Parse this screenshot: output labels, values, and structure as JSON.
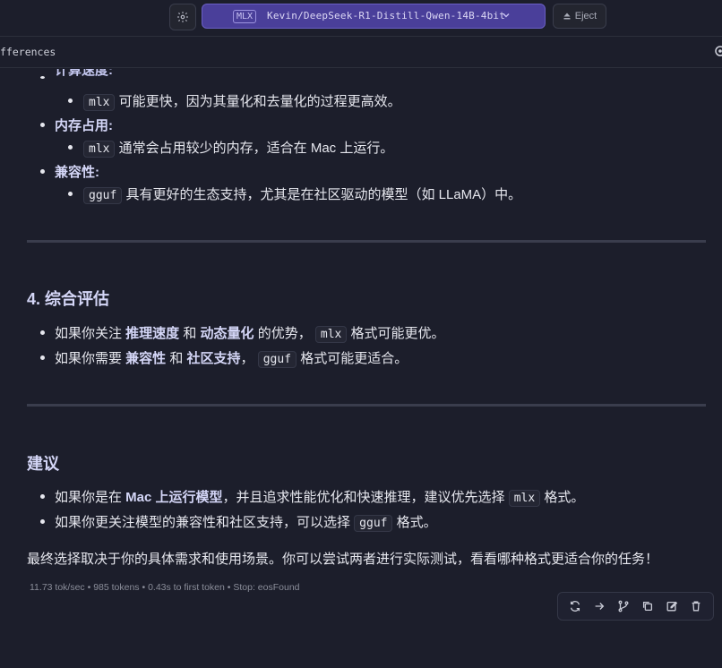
{
  "topbar": {
    "model_badge": "MLX",
    "model_name": "Kevin/DeepSeek-R1-Distill-Qwen-14B-4bit",
    "eject_label": "Eject"
  },
  "subbar": {
    "label": "fferences"
  },
  "section_top": {
    "clipped_heading": "计算速度:",
    "items": [
      {
        "label": "内存占用:",
        "code": "mlx",
        "text": "通常会占用较少的内存，适合在 Mac 上运行。"
      },
      {
        "label": "兼容性:",
        "code": "gguf",
        "text": "具有更好的生态支持，尤其是在社区驱动的模型（如 LLaMA）中。"
      }
    ],
    "first_sub": {
      "code": "mlx",
      "text": "可能更快，因为其量化和去量化的过程更高效。"
    }
  },
  "section4": {
    "heading": "4. 综合评估",
    "items": [
      {
        "pre": "如果你关注 ",
        "b1": "推理速度",
        "mid": " 和 ",
        "b2": "动态量化",
        "post": " 的优势，",
        "code": "mlx",
        "tail": " 格式可能更优。"
      },
      {
        "pre": "如果你需要 ",
        "b1": "兼容性",
        "mid": " 和 ",
        "b2": "社区支持",
        "post": "，",
        "code": "gguf",
        "tail": " 格式可能更适合。"
      }
    ]
  },
  "advice": {
    "heading": "建议",
    "items": [
      {
        "pre": "如果你是在 ",
        "b1": "Mac 上运行模型",
        "post": "，并且追求性能优化和快速推理，建议优先选择 ",
        "code": "mlx",
        "tail": " 格式。"
      },
      {
        "pre": "如果你更关注模型的兼容性和社区支持，可以选择 ",
        "code": "gguf",
        "tail": " 格式。"
      }
    ],
    "conclusion": "最终选择取决于你的具体需求和使用场景。你可以尝试两者进行实际测试，看看哪种格式更适合你的任务！"
  },
  "stats": "11.73 tok/sec • 985 tokens • 0.43s to first token • Stop: eosFound",
  "icons": {
    "gear": "gear-icon",
    "chevron": "chevron-down-icon",
    "eject": "eject-icon",
    "regenerate": "refresh-icon",
    "continue": "arrow-right-icon",
    "branch": "branch-icon",
    "copy": "copy-icon",
    "edit": "edit-icon",
    "delete": "trash-icon"
  }
}
